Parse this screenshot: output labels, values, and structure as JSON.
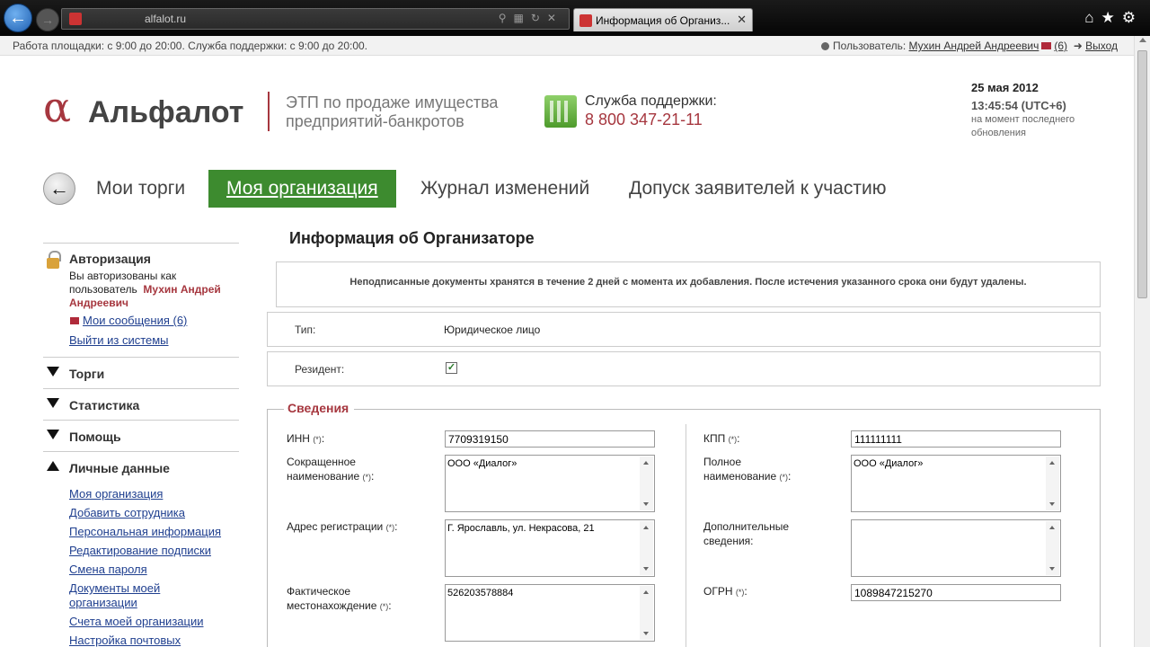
{
  "browser": {
    "url": "alfalot.ru",
    "tab_title": "Информация об Организ..."
  },
  "infobar": {
    "hours": "Работа площадки: с 9:00 до 20:00. Служба поддержки: с 9:00 до 20:00.",
    "user_label": "Пользователь:",
    "user_name": "Мухин Андрей Андреевич",
    "messages": "(6)",
    "logout": "Выход"
  },
  "header": {
    "logo_symbol": "α",
    "logo_name": "Альфалот",
    "tagline_line1": "ЭТП по продаже имущества",
    "tagline_line2": "предприятий-банкротов",
    "support_label": "Служба поддержки:",
    "support_phone": "8 800 347-21-11",
    "date": "25 мая 2012",
    "time": "13:45:54 (UTC+6)",
    "time_note_line1": "на момент последнего",
    "time_note_line2": "обновления"
  },
  "mainnav": {
    "back_arrow": "←",
    "items": [
      "Мои торги",
      "Моя организация",
      "Журнал изменений",
      "Допуск заявителей к участию"
    ]
  },
  "sidebar": {
    "auth_title": "Авторизация",
    "auth_text_1": "Вы авторизованы как",
    "auth_text_2": "пользователь",
    "auth_user_1": "Мухин Андрей",
    "auth_user_2": "Андреевич",
    "messages_link": "Мои сообщения (6)",
    "logout_link": "Выйти из системы",
    "sections": [
      "Торги",
      "Статистика",
      "Помощь",
      "Личные данные"
    ],
    "personal_links": [
      "Моя организация",
      "Добавить сотрудника",
      "Персональная информация",
      "Редактирование подписки",
      "Смена пароля",
      "Документы моей",
      "организации",
      "Счета моей организации",
      "Настройка почтовых"
    ]
  },
  "content": {
    "title": "Информация об Организаторе",
    "notice": "Неподписанные документы хранятся в течение 2 дней с момента их добавления. После истечения указанного срока они будут удалены.",
    "type_label": "Тип:",
    "type_value": "Юридическое лицо",
    "resident_label": "Резидент:",
    "resident_check": "✓",
    "section_title": "Сведения",
    "required_mark": "(*)",
    "fields": {
      "inn_label": "ИНН",
      "inn_value": "7709319150",
      "kpp_label": "КПП",
      "kpp_value": "111111111",
      "short_name_label_1": "Сокращенное",
      "short_name_label_2": "наименование",
      "short_name_value": "ООО «Диалог»",
      "full_name_label_1": "Полное",
      "full_name_label_2": "наименование",
      "full_name_value": "ООО «Диалог»",
      "reg_address_label": "Адрес регистрации",
      "reg_address_value": "Г. Ярославль, ул. Некрасова, 21",
      "extra_info_label_1": "Дополнительные",
      "extra_info_label_2": "сведения:",
      "extra_info_value": "",
      "actual_location_label_1": "Фактическое",
      "actual_location_label_2": "местонахождение",
      "actual_location_value": "526203578884",
      "ogrn_label": "ОГРН",
      "ogrn_value": "1089847215270"
    }
  }
}
